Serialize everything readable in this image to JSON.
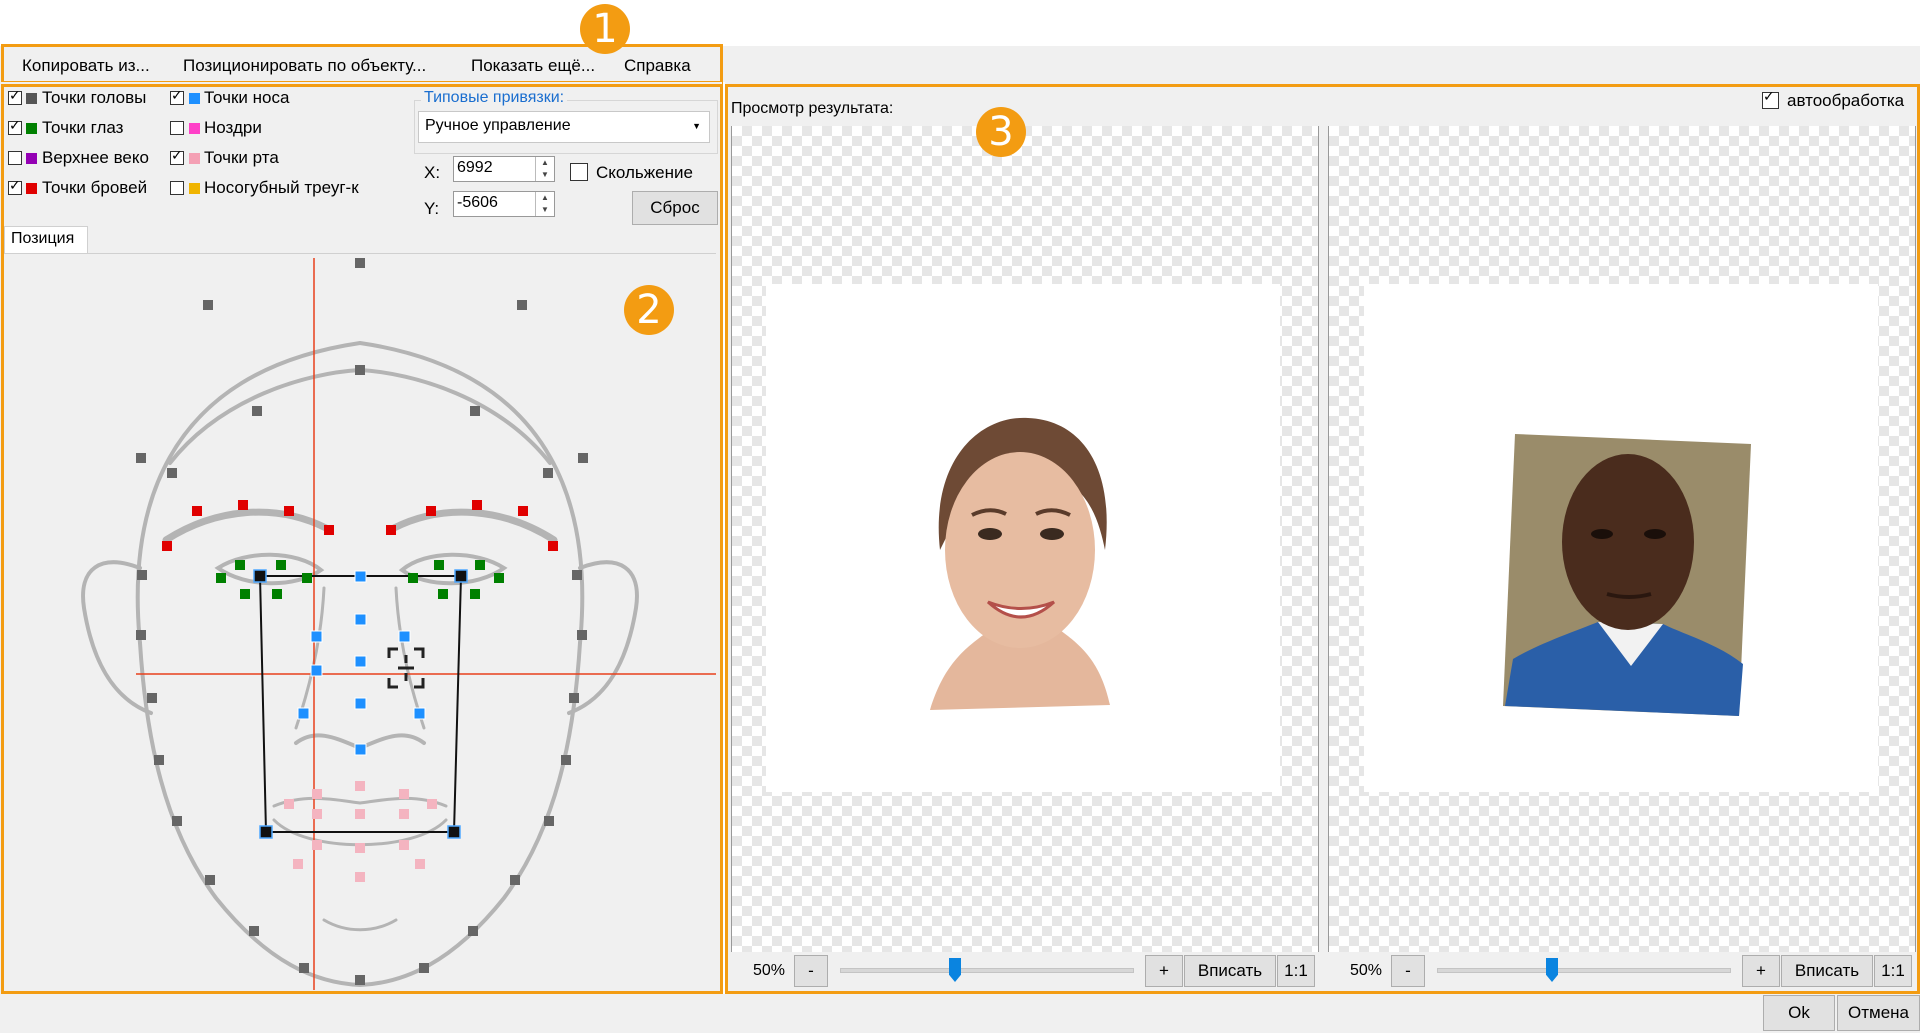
{
  "menu": {
    "copy_from": "Копировать из...",
    "position_by_object": "Позиционировать по объекту...",
    "show_more": "Показать ещё...",
    "help": "Справка"
  },
  "badges": {
    "one": "1",
    "two": "2",
    "three": "3"
  },
  "point_groups": [
    {
      "label": "Точки головы",
      "checked": true,
      "color": "#555555"
    },
    {
      "label": "Точки глаз",
      "checked": true,
      "color": "#008000"
    },
    {
      "label": "Верхнее веко",
      "checked": false,
      "color": "#9400b4"
    },
    {
      "label": "Точки бровей",
      "checked": true,
      "color": "#e00000"
    },
    {
      "label": "Точки носа",
      "checked": true,
      "color": "#1e90ff"
    },
    {
      "label": "Ноздри",
      "checked": false,
      "color": "#ff40c8"
    },
    {
      "label": "Точки рта",
      "checked": true,
      "color": "#f4a0b4"
    },
    {
      "label": "Носогубный треуг-к",
      "checked": false,
      "color": "#f0b400"
    }
  ],
  "typical_bindings": {
    "title": "Типовые привязки:",
    "selected": "Ручное управление"
  },
  "coords": {
    "x_label": "X:",
    "x_value": "6992",
    "y_label": "Y:",
    "y_value": "-5606"
  },
  "sliding": {
    "label": "Скольжение",
    "checked": false
  },
  "reset_label": "Сброс",
  "tab_position": "Позиция",
  "preview": {
    "title": "Просмотр результата:",
    "autoprocess_label": "автообработка",
    "autoprocess_checked": true
  },
  "zoom_left": {
    "percent": "50%",
    "minus": "-",
    "plus": "+",
    "fit": "Вписать",
    "one_to_one": "1:1",
    "level": 0.5
  },
  "zoom_right": {
    "percent": "50%",
    "minus": "-",
    "plus": "+",
    "fit": "Вписать",
    "one_to_one": "1:1",
    "level": 0.5
  },
  "footer": {
    "ok": "Ok",
    "cancel": "Отмена"
  },
  "colors": {
    "accent": "#f39c12",
    "guide": "#e8401c",
    "skin": "#d9a27f",
    "suit": "#2a5fa8"
  }
}
